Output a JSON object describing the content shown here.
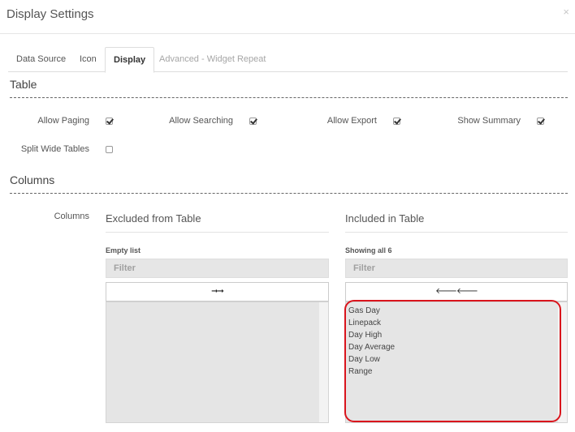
{
  "modal": {
    "title": "Display Settings",
    "close": "×"
  },
  "tabs": [
    {
      "label": "Data Source",
      "state": "normal"
    },
    {
      "label": "Icon",
      "state": "normal"
    },
    {
      "label": "Display",
      "state": "active"
    },
    {
      "label": "Advanced - Widget Repeat",
      "state": "disabled"
    }
  ],
  "table_section": {
    "title": "Table",
    "options": [
      {
        "label": "Allow Paging",
        "checked": true
      },
      {
        "label": "Allow Searching",
        "checked": true
      },
      {
        "label": "Allow Export",
        "checked": true
      },
      {
        "label": "Show Summary",
        "checked": true
      },
      {
        "label": "Split Wide Tables",
        "checked": false
      }
    ]
  },
  "columns_section": {
    "title": "Columns",
    "field_label": "Columns",
    "excluded": {
      "heading": "Excluded from Table",
      "info": "Empty list",
      "filter_placeholder": "Filter",
      "move_button": "➞➞",
      "items": []
    },
    "included": {
      "heading": "Included in Table",
      "info": "Showing all 6",
      "filter_placeholder": "Filter",
      "move_button": "🡐🡐",
      "items": [
        "Gas Day",
        "Linepack",
        "Day High",
        "Day Average",
        "Day Low",
        "Range"
      ]
    }
  },
  "colors": {
    "highlight": "#d9141c",
    "list_bg": "#e5e5e5"
  }
}
